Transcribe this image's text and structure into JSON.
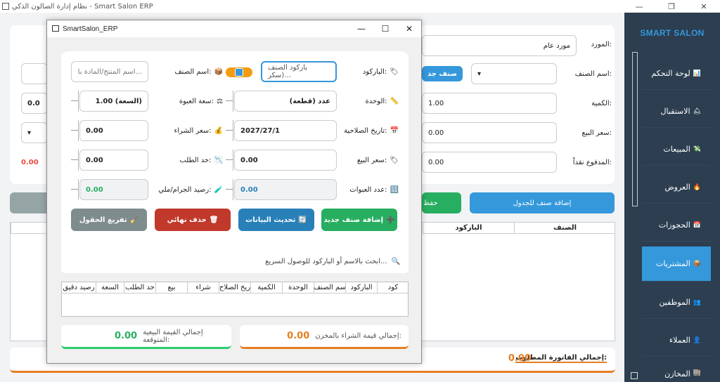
{
  "window": {
    "title": "نظام إدارة الصالون الذكي - Smart Salon ERP",
    "min": "—",
    "max": "❐",
    "close": "✕"
  },
  "sidebar": {
    "brand": "SMART SALON",
    "items": [
      {
        "label": "لوحة التحكم",
        "icon": "📊"
      },
      {
        "label": "الاستقبال",
        "icon": "🛎"
      },
      {
        "label": "المبيعات",
        "icon": "💸"
      },
      {
        "label": "العروض",
        "icon": "🔥"
      },
      {
        "label": "الحجوزات",
        "icon": "📅"
      },
      {
        "label": "المشتريات",
        "icon": "📦"
      },
      {
        "label": "الموظفين",
        "icon": "👥"
      },
      {
        "label": "العملاء",
        "icon": "👤"
      },
      {
        "label": "المخازن",
        "icon": "🏬"
      }
    ]
  },
  "main": {
    "supplier_label": "المورد:",
    "supplier_value": "مورد عام",
    "item_name_label": "اسم الصنف:",
    "new_item_btn": "صنف جد",
    "qty_label": "الكمية:",
    "qty_value": "1.00",
    "sell_price_label": "سعر البيع:",
    "sell_price_value": "0.00",
    "paid_label": "المدفوع نقداً:",
    "paid_value": "0.00",
    "left_qty_value": "0.0",
    "red_total": "0.00",
    "add_to_table_btn": "إضافة صنف للجدول",
    "save_btn_partial": "حفظ",
    "table_headers": [
      "الصنف",
      "الباركود"
    ],
    "invoice_total_label": "إجمالي الفاتورة المطلوب:",
    "invoice_total_value": "0.00"
  },
  "dialog": {
    "title": "SmartSalon_ERP",
    "barcode_label": "الباركود:",
    "barcode_placeholder": "باركود الصنف (سكر...",
    "item_name_label": "اسم الصنف:",
    "item_name_placeholder": "اسم المنتج/المادة با...",
    "unit_label": "الوحدة:",
    "unit_value": "عدد (قطعة)",
    "pack_label": "سعة العبوة:",
    "pack_value": "1.00 (السعة)",
    "expiry_label": "تاريخ الصلاحية:",
    "expiry_value": "2027/27/1",
    "buy_price_label": "سعر الشراء:",
    "buy_price_value": "0.00",
    "sell_price_label": "سعر البيع:",
    "sell_price_value": "0.00",
    "reorder_label": "حد الطلب:",
    "reorder_value": "0.00",
    "packs_label": "عدد العبوات:",
    "packs_value": "0.00",
    "balance_label": "رصيد الجرام/ملي:",
    "balance_value": "0.00",
    "btn_add": "إضافة صنف جديد",
    "btn_update": "تحديث البيانات",
    "btn_delete": "حذف نهائي",
    "btn_clear": "تفريغ الحقول",
    "search_placeholder": "ابحث بالاسم أو الباركود للوصول السريع...",
    "table_headers": [
      "كود",
      "الباركود",
      "سم الصنف",
      "الوحدة",
      "الكمية",
      "ريخ الصلاح",
      "شراء",
      "بيع",
      "حد الطلب",
      "السعة",
      "رصيد دقيق"
    ],
    "total_buy_label": "إجمالي قيمة الشراء بالمخزن:",
    "total_buy_value": "0.00",
    "total_sell_label": "إجمالي القيمة البيعية المتوقعة:",
    "total_sell_value": "0.00"
  },
  "colors": {
    "sidebar": "#2c3e50",
    "accent": "#3498db",
    "green": "#27ae60",
    "red": "#c0392b",
    "orange": "#e67e22",
    "gray": "#7f8c8d"
  }
}
